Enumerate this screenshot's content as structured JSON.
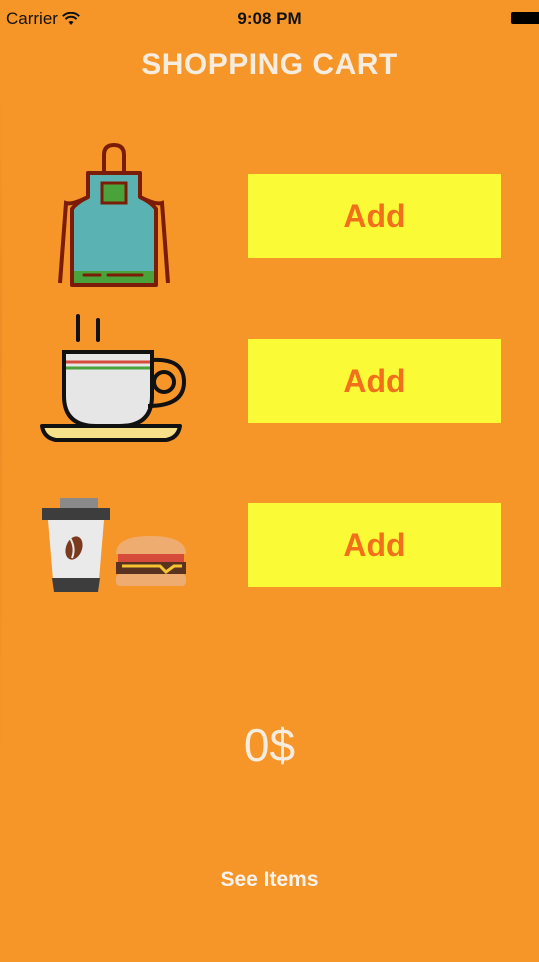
{
  "status_bar": {
    "carrier": "Carrier",
    "time": "9:08 PM",
    "wifi_icon": "wifi-icon",
    "battery_icon": "battery-icon"
  },
  "title": "SHOPPING CART",
  "products": [
    {
      "icon": "apron-icon",
      "button_label": "Add"
    },
    {
      "icon": "coffee-cup-icon",
      "button_label": "Add"
    },
    {
      "icon": "coffee-and-burger-icon",
      "button_label": "Add"
    }
  ],
  "total": "0$",
  "see_items_label": "See Items",
  "colors": {
    "background": "#f69628",
    "button_bg": "#fafa36",
    "button_text": "#f26f1b",
    "title_text": "#f7ece0"
  }
}
